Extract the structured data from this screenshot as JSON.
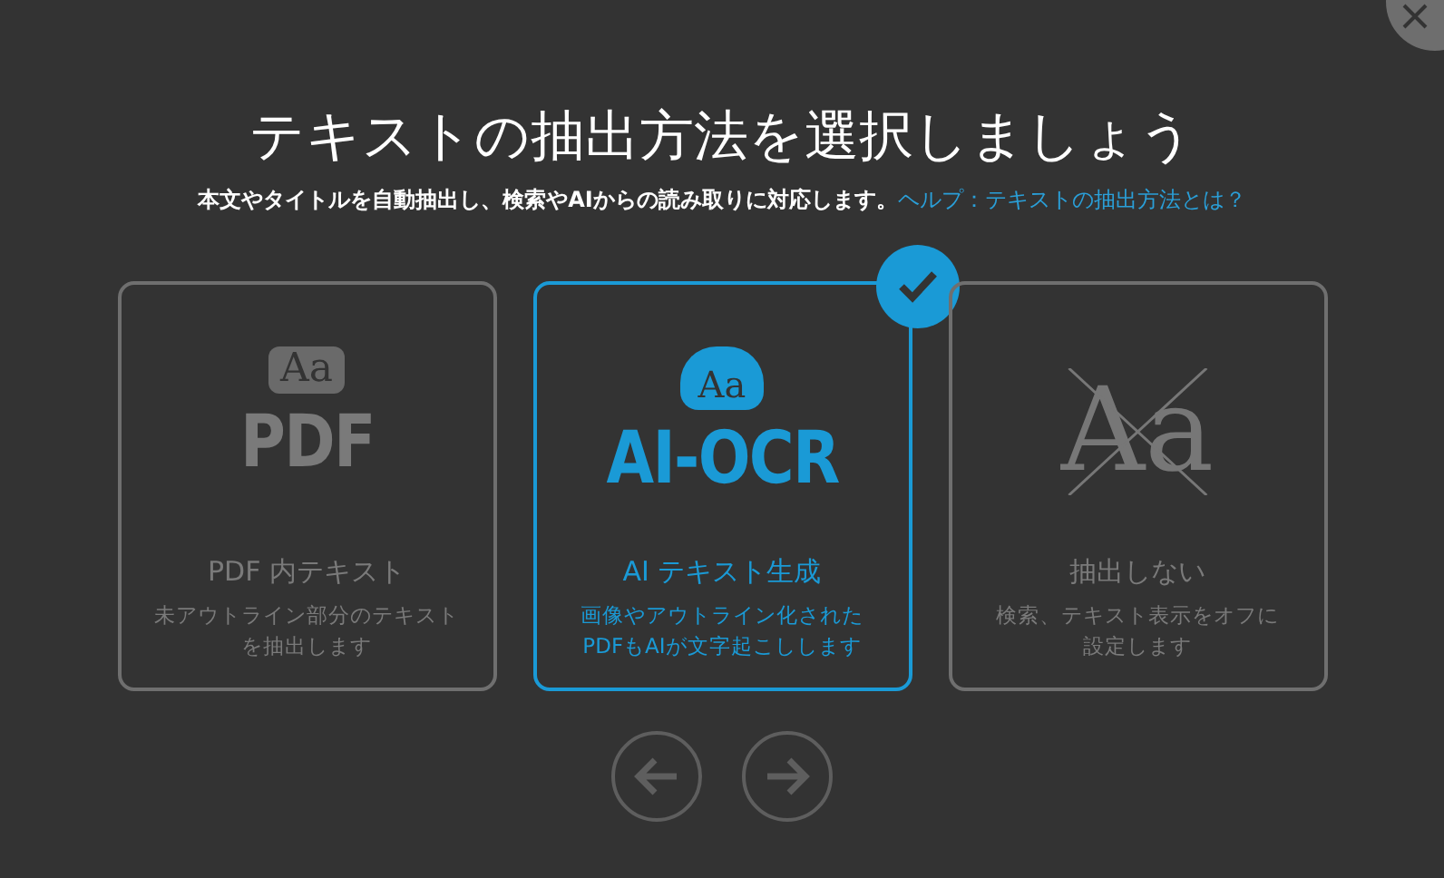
{
  "title": "テキストの抽出方法を選択しましょう",
  "subtitle": "本文やタイトルを自動抽出し、検索やAIからの読み取りに対応します。",
  "help_link": "ヘルプ：テキストの抽出方法とは？",
  "options": [
    {
      "kind": "pdf",
      "glyph": "Aa",
      "logo": "PDF",
      "label": "PDF 内テキスト",
      "description": [
        "未アウトライン部分のテキスト",
        "を抽出します"
      ],
      "selected": false
    },
    {
      "kind": "ocr",
      "glyph": "Aa",
      "logo": "AI-OCR",
      "label": "AI テキスト生成",
      "description": [
        "画像やアウトライン化された",
        "PDFもAIが文字起こしします"
      ],
      "selected": true
    },
    {
      "kind": "none",
      "glyph": "Aa",
      "label": "抽出しない",
      "description": [
        "検索、テキスト表示をオフに",
        "設定します"
      ],
      "selected": false
    }
  ]
}
